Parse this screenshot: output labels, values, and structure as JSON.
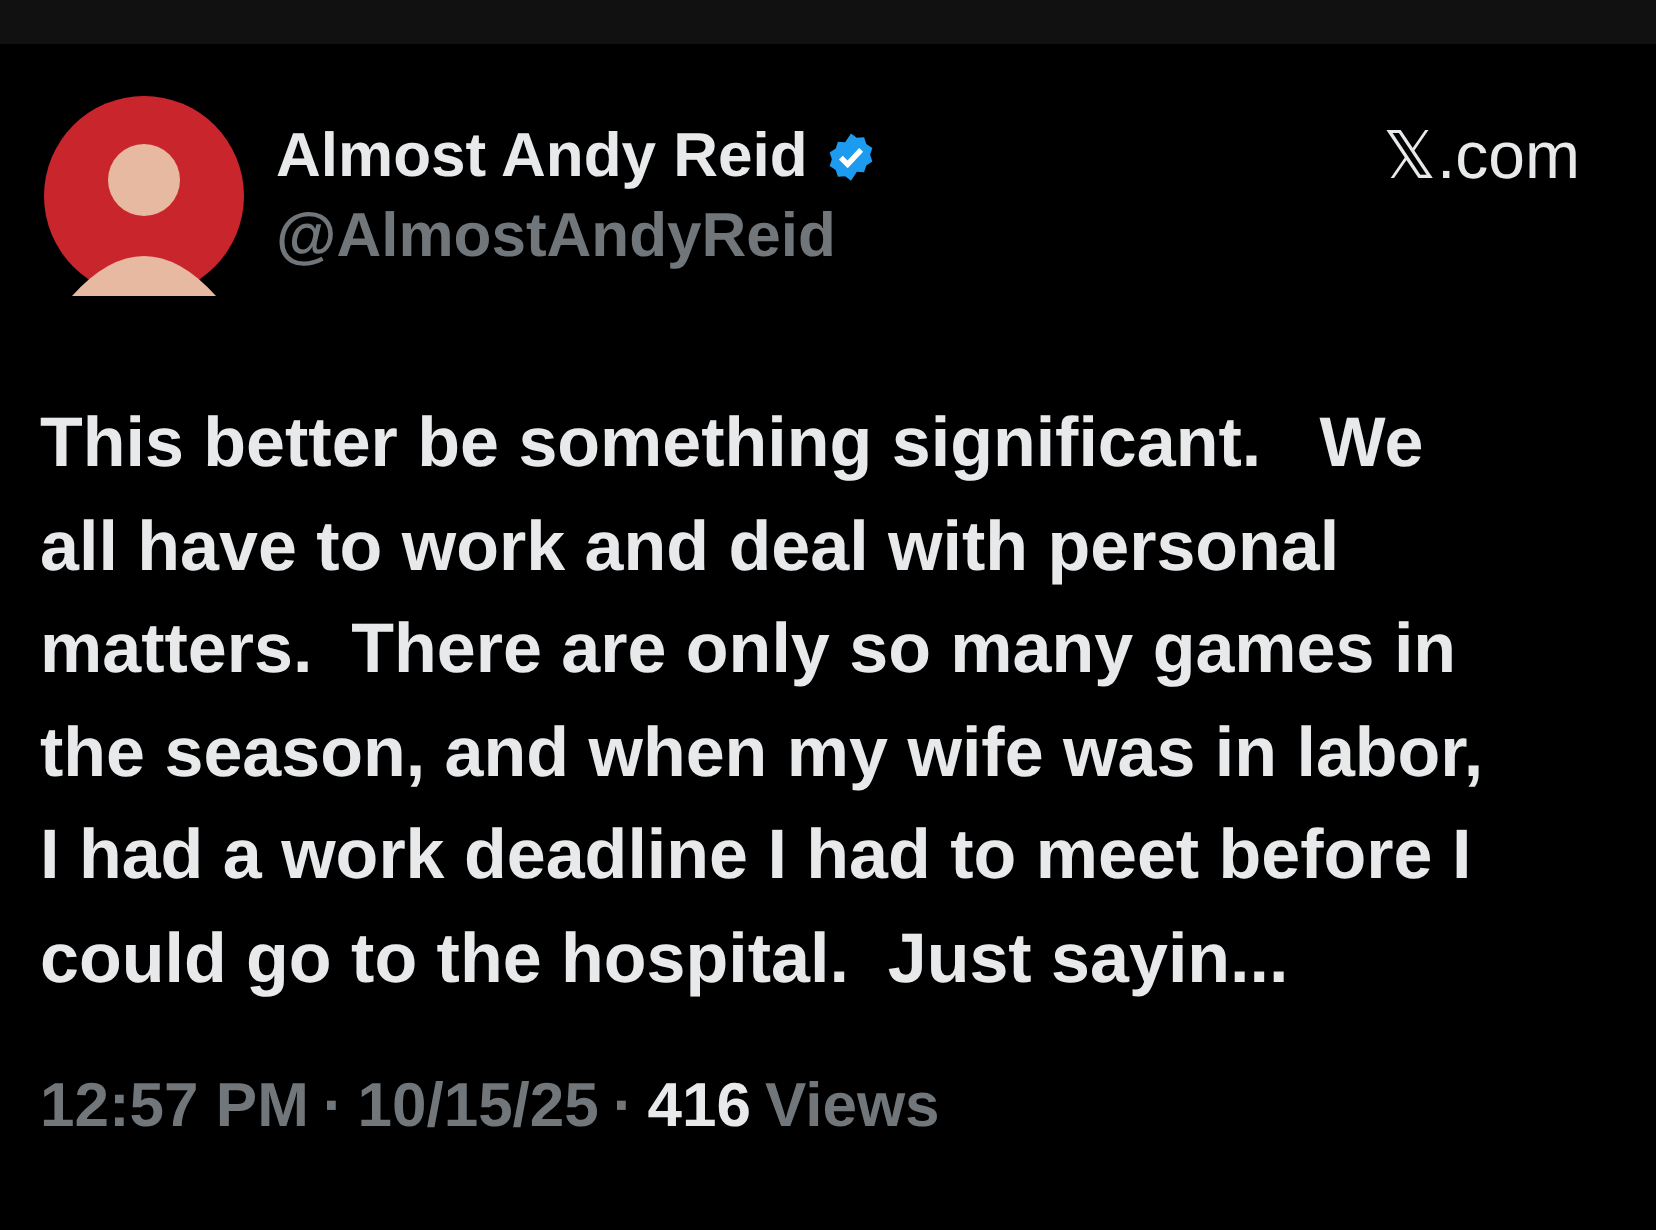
{
  "author": {
    "name": "Almost Andy Reid",
    "verified": true,
    "handle": "@AlmostAndyReid"
  },
  "site": "𝕏.com",
  "text": "This better be something significant.   We\nall have to work and deal with personal\nmatters.  There are only so many games in\nthe season, and when my wife was in labor,\nI had a work deadline I had to meet before I\ncould go to the hospital.  Just sayin...",
  "meta": {
    "time": "12:57 PM",
    "separator_1": "·",
    "date": "10/15/25",
    "separator_2": "·",
    "views_count": "416",
    "views_label": "Views"
  }
}
